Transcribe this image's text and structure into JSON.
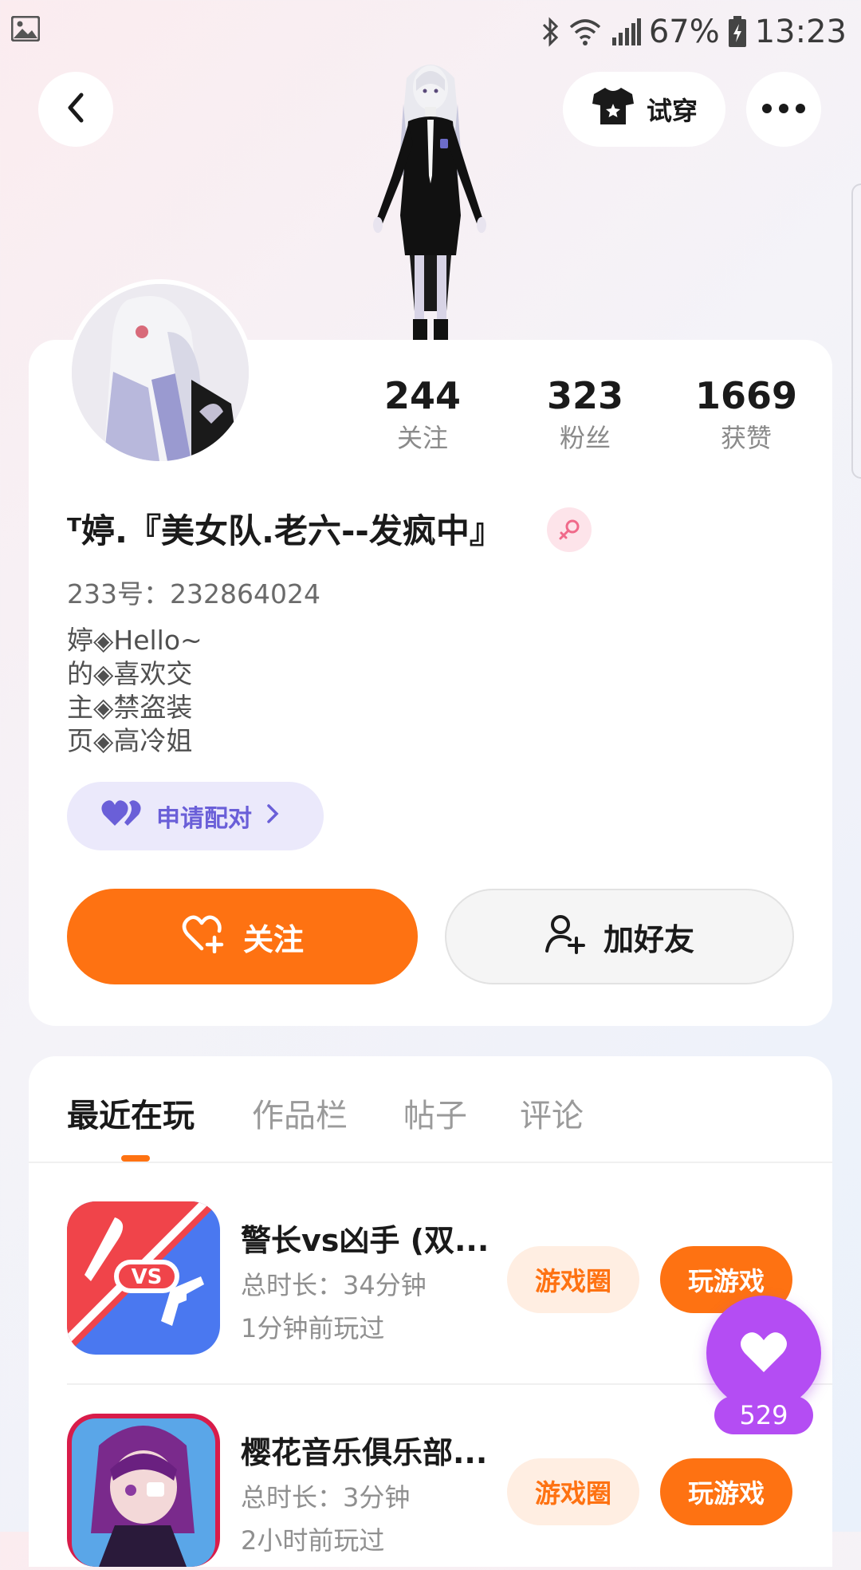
{
  "status_bar": {
    "battery": "67%",
    "time": "13:23",
    "icons": [
      "gallery-icon",
      "bluetooth-icon",
      "wifi-icon",
      "signal-icon",
      "battery-icon"
    ]
  },
  "header": {
    "back_icon": "chevron-left-icon",
    "tryon_label": "试穿",
    "tryon_icon": "tshirt-icon",
    "more_icon": "more-dots-icon"
  },
  "profile": {
    "stats": [
      {
        "value": "244",
        "label": "关注"
      },
      {
        "value": "323",
        "label": "粉丝"
      },
      {
        "value": "1669",
        "label": "获赞"
      }
    ],
    "username": "ᵀ婷.『美女队.老六--发疯中』",
    "gender_icon": "female-icon",
    "user_id": "233号：232864024",
    "bio": [
      "婷◈Hello~",
      "的◈喜欢交",
      "主◈禁盗装",
      "页◈高冷姐"
    ],
    "pair_label": "申请配对",
    "follow_label": "关注",
    "add_friend_label": "加好友"
  },
  "tabs": [
    {
      "label": "最近在玩",
      "active": true
    },
    {
      "label": "作品栏",
      "active": false
    },
    {
      "label": "帖子",
      "active": false
    },
    {
      "label": "评论",
      "active": false
    }
  ],
  "games": [
    {
      "title": "警长vs凶手 (双...",
      "duration": "总时长：34分钟",
      "last_played": "1分钟前玩过",
      "circle_label": "游戏圈",
      "play_label": "玩游戏"
    },
    {
      "title": "樱花音乐俱乐部...",
      "duration": "总时长：3分钟",
      "last_played": "2小时前玩过",
      "circle_label": "游戏圈",
      "play_label": "玩游戏"
    }
  ],
  "like_fab": {
    "count": "529",
    "icon": "heart-icon"
  },
  "colors": {
    "accent": "#fe7212",
    "purple": "#b44df3",
    "pair": "#6a5fd8"
  }
}
